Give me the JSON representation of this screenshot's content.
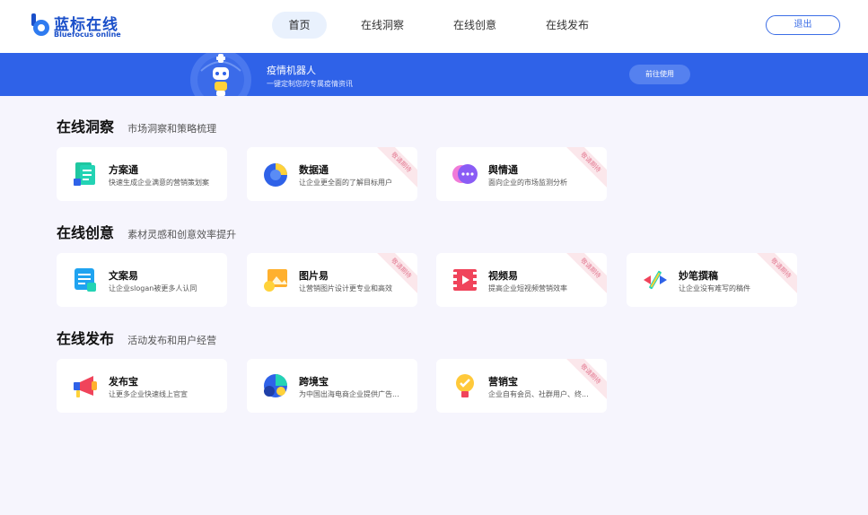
{
  "header": {
    "logo_title": "蓝标在线",
    "logo_sub": "Bluefocus online",
    "nav": [
      {
        "label": "首页",
        "active": true
      },
      {
        "label": "在线洞察"
      },
      {
        "label": "在线创意"
      },
      {
        "label": "在线发布"
      }
    ],
    "logout_label": "退出"
  },
  "banner": {
    "title": "疫情机器人",
    "subtitle": "一键定制您的专属疫情资讯",
    "button_label": "前往使用"
  },
  "sections": [
    {
      "title": "在线洞察",
      "subtitle": "市场洞察和策略梳理",
      "cards": [
        {
          "name": "方案通",
          "desc": "快速生成企业满意的营销策划案",
          "icon": "document-plan-icon",
          "ribbon": ""
        },
        {
          "name": "数据通",
          "desc": "让企业更全面的了解目标用户",
          "icon": "data-chart-icon",
          "ribbon": "敬请期待"
        },
        {
          "name": "舆情通",
          "desc": "面向企业的市场监测分析",
          "icon": "chat-bubble-icon",
          "ribbon": "敬请期待"
        }
      ]
    },
    {
      "title": "在线创意",
      "subtitle": "素材灵感和创意效率提升",
      "cards": [
        {
          "name": "文案易",
          "desc": "让企业slogan被更多人认同",
          "icon": "copywriting-icon",
          "ribbon": ""
        },
        {
          "name": "图片易",
          "desc": "让营销图片设计更专业和高效",
          "icon": "image-icon",
          "ribbon": "敬请期待"
        },
        {
          "name": "视频易",
          "desc": "提高企业短视频营销效率",
          "icon": "video-film-icon",
          "ribbon": "敬请期待"
        },
        {
          "name": "妙笔撰稿",
          "desc": "让企业没有难写的稿件",
          "icon": "pen-icon",
          "ribbon": "敬请期待"
        }
      ]
    },
    {
      "title": "在线发布",
      "subtitle": "活动发布和用户经营",
      "cards": [
        {
          "name": "发布宝",
          "desc": "让更多企业快速线上官宣",
          "icon": "megaphone-icon",
          "ribbon": ""
        },
        {
          "name": "跨境宝",
          "desc": "为中国出海电商企业提供广告...",
          "icon": "globe-icon",
          "ribbon": ""
        },
        {
          "name": "营销宝",
          "desc": "企业自有会员、社群用户、终...",
          "icon": "lightbulb-icon",
          "ribbon": "敬请期待"
        }
      ]
    }
  ],
  "colors": {
    "brand": "#1a4fc9",
    "banner": "#2f62e8",
    "background": "#f6f5fd",
    "ribbon": "#fbe7eb"
  }
}
